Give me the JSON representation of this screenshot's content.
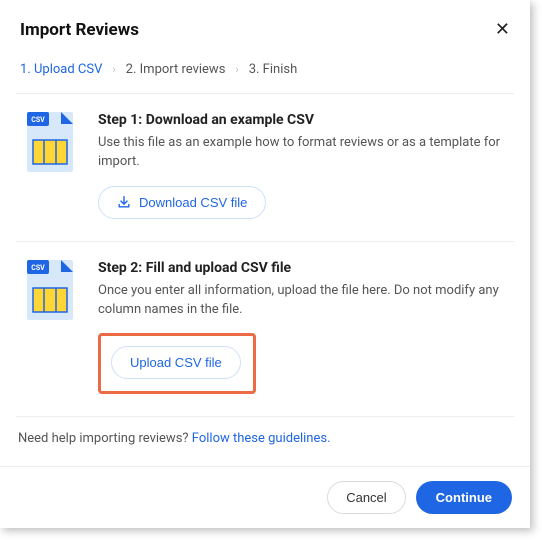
{
  "header": {
    "title": "Import Reviews"
  },
  "breadcrumbs": {
    "step1": "1.  Upload CSV",
    "step2": "2.  Import reviews",
    "step3": "3.  Finish"
  },
  "section1": {
    "title": "Step 1: Download an example CSV",
    "desc": "Use this file as an example how to format reviews or as a template for import.",
    "button": "Download CSV file"
  },
  "section2": {
    "title": "Step 2: Fill and upload CSV file",
    "desc": "Once you enter all information, upload the file here. Do not modify any column names in the file.",
    "button": "Upload CSV file"
  },
  "help": {
    "text": "Need help importing reviews? ",
    "link": "Follow these guidelines."
  },
  "footer": {
    "cancel": "Cancel",
    "continue": "Continue"
  }
}
